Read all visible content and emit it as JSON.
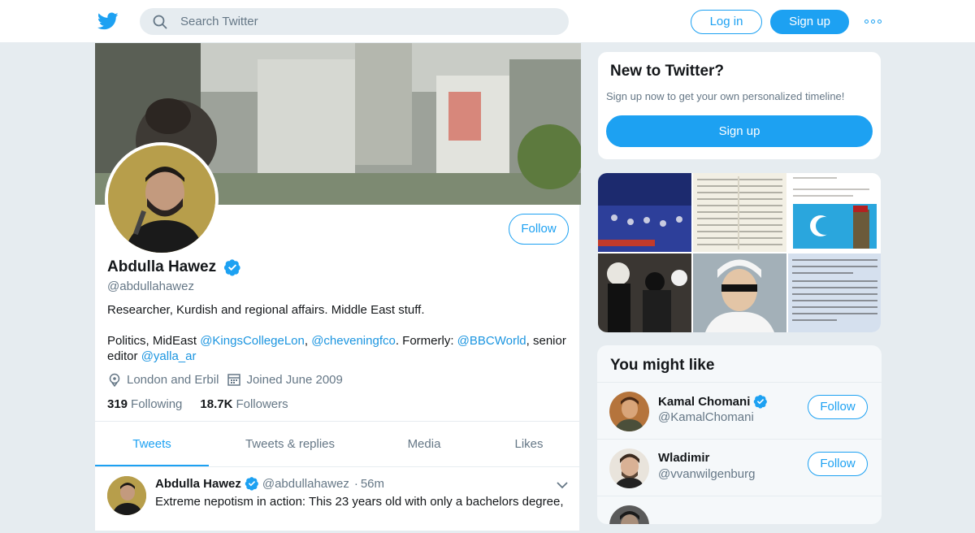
{
  "nav": {
    "search_placeholder": "Search Twitter",
    "login_label": "Log in",
    "signup_label": "Sign up",
    "more_icon": "more-dots-icon"
  },
  "profile": {
    "follow_label": "Follow",
    "name": "Abdulla Hawez",
    "handle": "@abdullahawez",
    "bio_line1": "Researcher, Kurdish and regional affairs. Middle East stuff.",
    "bio_part1": "Politics, MidEast ",
    "bio_link1": "@KingsCollegeLon",
    "bio_sep1": ", ",
    "bio_link2": "@cheveningfco",
    "bio_part2": ". Formerly: ",
    "bio_link3": "@BBCWorld",
    "bio_part3": ", senior editor ",
    "bio_link4": "@yalla_ar",
    "location": "London and Erbil",
    "joined": "Joined June 2009",
    "following_count": "319",
    "following_label": "Following",
    "followers_count": "18.7K",
    "followers_label": "Followers"
  },
  "tabs": [
    {
      "label": "Tweets"
    },
    {
      "label": "Tweets & replies"
    },
    {
      "label": "Media"
    },
    {
      "label": "Likes"
    }
  ],
  "tweet": {
    "name": "Abdulla Hawez",
    "handle": "@abdullahawez",
    "dot": "·",
    "time": "56m",
    "text": "Extreme nepotism in action: This 23 years old with only a bachelors degree,"
  },
  "new_to_twitter": {
    "title": "New to Twitter?",
    "subtitle": "Sign up now to get your own personalized timeline!",
    "signup_label": "Sign up"
  },
  "you_might_like": {
    "title": "You might like",
    "items": [
      {
        "name": "Kamal Chomani",
        "handle": "@KamalChomani",
        "verified": true,
        "follow": "Follow"
      },
      {
        "name": "Wladimir",
        "handle": "@vvanwilgenburg",
        "verified": false,
        "follow": "Follow"
      }
    ]
  },
  "colors": {
    "accent": "#1da1f2",
    "link": "#1b95e0",
    "muted": "#657786",
    "background": "#e6ecf0"
  }
}
